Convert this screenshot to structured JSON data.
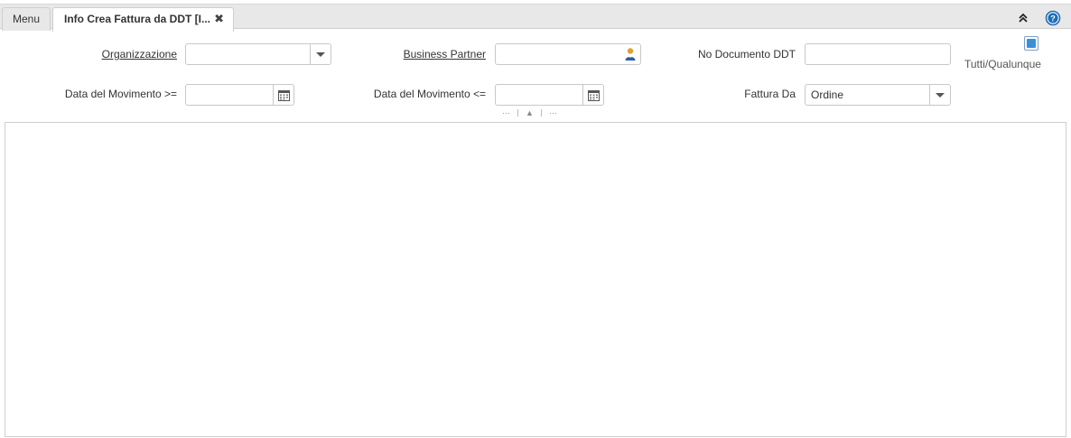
{
  "tabs": {
    "menu_label": "Menu",
    "active_label": "Info Crea Fattura da DDT [I...",
    "close_glyph": "✖"
  },
  "toolbar": {
    "collapse_icon": "double-chevron-up-icon",
    "help_icon": "help-icon",
    "help_color": "#1f6db5"
  },
  "form": {
    "organizzazione": {
      "label": "Organizzazione",
      "value": ""
    },
    "business_partner": {
      "label": "Business Partner",
      "value": ""
    },
    "no_documento_ddt": {
      "label": "No Documento DDT",
      "value": ""
    },
    "tutti_qualunque": {
      "label": "Tutti/Qualunque",
      "checked": true
    },
    "data_movimento_from": {
      "label": "Data del Movimento >=",
      "value": ""
    },
    "data_movimento_to": {
      "label": "Data del Movimento <=",
      "value": ""
    },
    "fattura_da": {
      "label": "Fattura Da",
      "value": "Ordine"
    }
  },
  "splitter": {
    "left": "···",
    "up": "▲",
    "right": "···"
  },
  "colors": {
    "accent": "#3a8fd8",
    "border": "#c8c8c8"
  }
}
